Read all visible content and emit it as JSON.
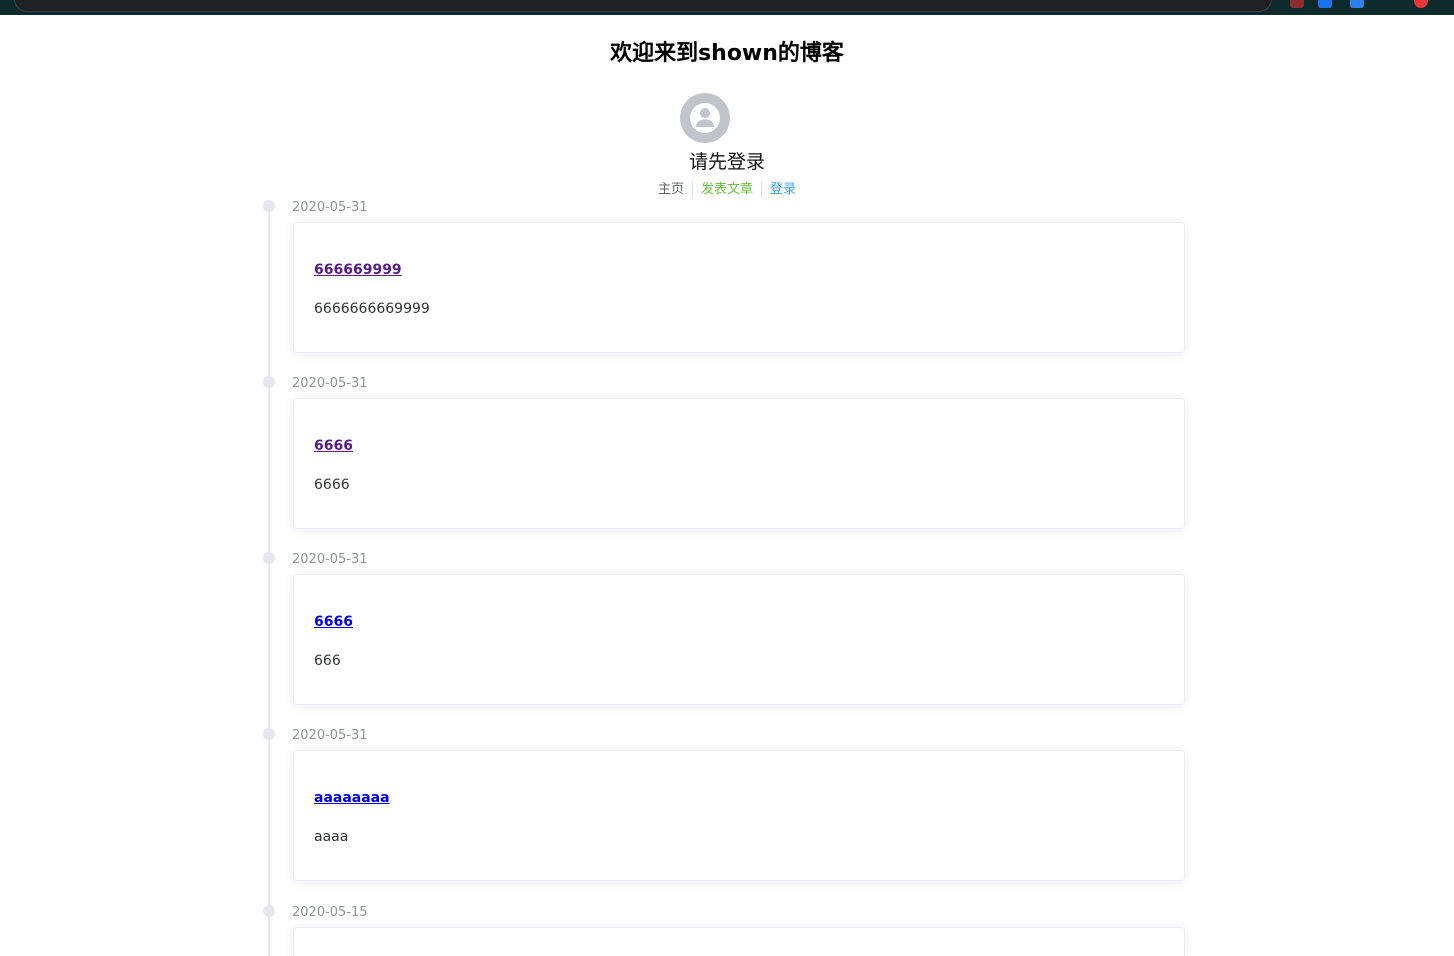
{
  "header": {
    "title": "欢迎来到shown的博客",
    "login_prompt": "请先登录"
  },
  "nav": {
    "home": "主页",
    "publish": "发表文章",
    "login": "登录"
  },
  "posts": [
    {
      "date": "2020-05-31",
      "title": "666669999",
      "summary": "6666666669999",
      "link_state": "visited"
    },
    {
      "date": "2020-05-31",
      "title": "6666",
      "summary": "6666",
      "link_state": "visited"
    },
    {
      "date": "2020-05-31",
      "title": "6666",
      "summary": "666",
      "link_state": "unvisited"
    },
    {
      "date": "2020-05-31",
      "title": "aaaaaaaa",
      "summary": "aaaa",
      "link_state": "unvisited"
    },
    {
      "date": "2020-05-15",
      "title": "",
      "summary": "",
      "link_state": "unvisited"
    }
  ],
  "colors": {
    "nav_home": "#606266",
    "nav_publish": "#67c23a",
    "nav_login": "#409eff",
    "link_visited": "#551a8b",
    "link_unvisited": "#0000ee",
    "timeline": "#e4e7ed",
    "date_text": "#909399",
    "avatar_bg": "#c0c4cc"
  },
  "icons": {
    "avatar": "user-avatar-icon"
  }
}
